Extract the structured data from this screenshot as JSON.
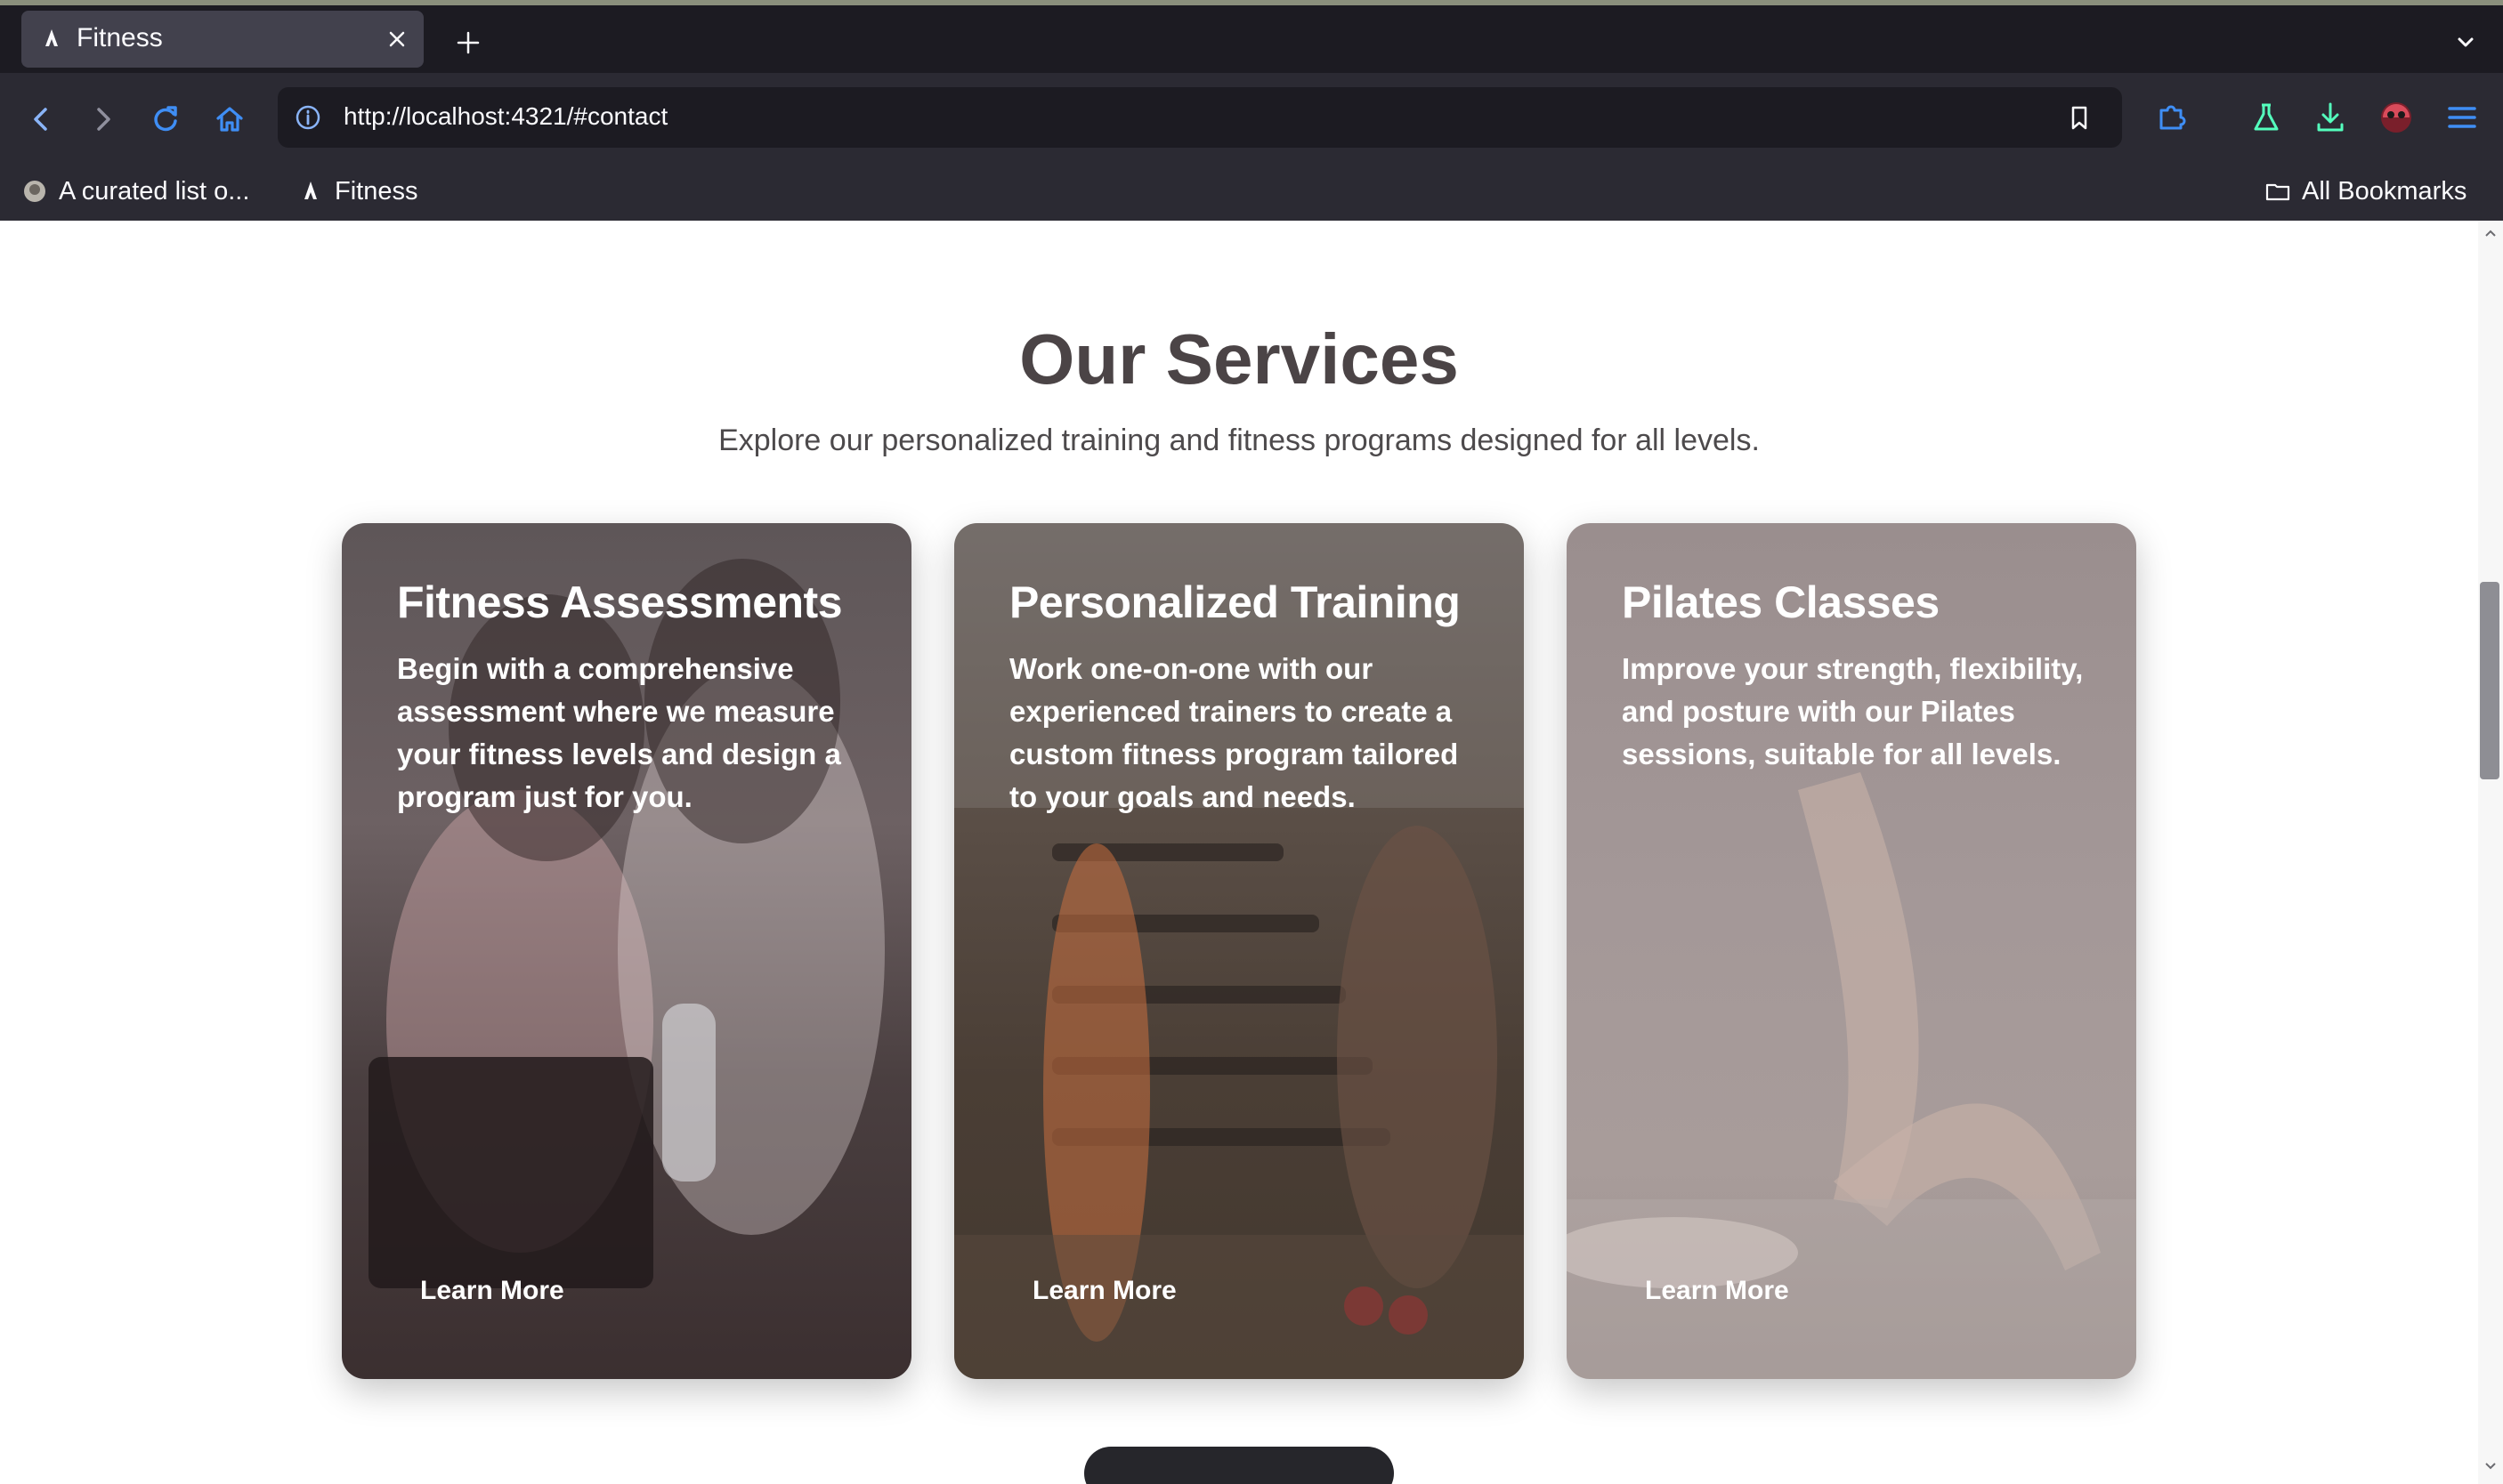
{
  "browser": {
    "tab": {
      "title": "Fitness"
    },
    "url": "http://localhost:4321/#contact",
    "bookmarks": [
      {
        "label": "A curated list o..."
      },
      {
        "label": "Fitness"
      }
    ],
    "all_bookmarks_label": "All Bookmarks"
  },
  "services": {
    "title": "Our Services",
    "subtitle": "Explore our personalized training and fitness programs designed for all levels.",
    "cards": [
      {
        "title": "Fitness Assessments",
        "text": "Begin with a comprehensive assessment where we measure your fitness levels and design a program just for you.",
        "link": "Learn More"
      },
      {
        "title": "Personalized Training",
        "text": "Work one-on-one with our experienced trainers to create a custom fitness program tailored to your goals and needs.",
        "link": "Learn More"
      },
      {
        "title": "Pilates Classes",
        "text": "Improve your strength, flexibility, and posture with our Pilates sessions, suitable for all levels.",
        "link": "Learn More"
      }
    ]
  },
  "colors": {
    "accent": "#0060df",
    "chrome_dark": "#1c1b22",
    "chrome": "#2b2a33",
    "heading": "#4b4446"
  }
}
